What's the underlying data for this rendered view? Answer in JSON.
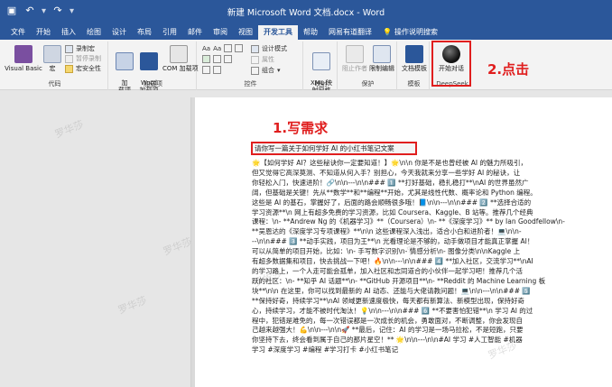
{
  "titlebar": {
    "title": "新建 Microsoft Word 文档.docx  -  Word",
    "qat": [
      "save-icon",
      "undo-icon",
      "redo-icon",
      "customize-icon"
    ]
  },
  "tabs": [
    {
      "label": "文件"
    },
    {
      "label": "开始"
    },
    {
      "label": "插入"
    },
    {
      "label": "绘图"
    },
    {
      "label": "设计"
    },
    {
      "label": "布局"
    },
    {
      "label": "引用"
    },
    {
      "label": "邮件"
    },
    {
      "label": "审阅"
    },
    {
      "label": "视图"
    },
    {
      "label": "开发工具"
    },
    {
      "label": "帮助"
    },
    {
      "label": "网易有道翻译"
    },
    {
      "label": "操作说明搜索"
    }
  ],
  "active_tab": "开发工具",
  "ribbon": {
    "code": {
      "label": "代码",
      "visual_basic": "Visual Basic",
      "macros": "宏",
      "record_macro": "录制宏",
      "pause_recording": "暂停录制",
      "macro_security": "宏安全性"
    },
    "addins": {
      "label": "加载项",
      "addins_btn": "加\n载项",
      "word_addins": "Word\n加载项",
      "com_addins": "COM 加载项"
    },
    "controls": {
      "label": "控件",
      "design_mode": "设计模式",
      "properties": "属性",
      "group": "组合"
    },
    "mapping": {
      "label": "映射",
      "xml_mapping": "XML 映\n射窗格"
    },
    "protect": {
      "label": "保护",
      "block_authors": "阻止作者",
      "restrict_editing": "限制编辑"
    },
    "templates": {
      "label": "模板",
      "document_template": "文档模板"
    },
    "deepseek": {
      "label": "DeepSeek",
      "start_chat": "开始对话"
    }
  },
  "annotations": {
    "step1": "1.写需求",
    "step2": "2.点击"
  },
  "document": {
    "prompt": "请你写一篇关于如何学好 AI 的小红书笔记文案",
    "lines": [
      "🌟【如何学好 AI？这些秘诀你一定要知道！】🌟\\n\\n 你是不是也曾经被 AI 的魅力所吸引，",
      "但又觉得它高深莫测、不知道从何入手？别担心，今天我就来分享一些学好 AI 的秘诀，让",
      "你轻松入门，快速进阶！🔗\\n\\n---\\n\\n### 1️⃣ **打好基础，稳扎稳打**\\nAI 的世界虽然广",
      "阔，但基础是关键！先从**数学**和**编程**开始，尤其是线性代数、概率论和 Python 编程。",
      "这些是 AI 的基石，掌握好了，后面的路会顺畅很多哦！📘\\n\\n---\\n\\n### 2️⃣ **选择合适的",
      "学习资源**\\n 网上有超多免费的学习资源，比如 Coursera、Kaggle、B 站等。推荐几个经典",
      "课程：\\n- **Andrew Ng 的《机器学习》**（Coursera）\\n- **《深度学习》** by Ian Goodfellow\\n-",
      "**吴恩达的《深度学习专项课程》**\\n\\n 这些课程深入浅出，适合小白和进阶者！💻\\n\\n-",
      "--\\n\\n### 3️⃣ **动手实践，项目为王**\\n 光看理论是不够的，动手做项目才能真正掌握 AI！",
      "可以从简单的项目开始，比如：\\n- 手写数字识别\\n- 情感分析\\n- 图像分类\\n\\nKaggle 上",
      "有超多数据集和项目，快去挑战一下吧！🔥\\n\\n---\\n\\n### 4️⃣ **加入社区，交流学习**\\nAI",
      "的学习路上，一个人走可能会孤单，加入社区和志同道合的小伙伴一起学习吧！推荐几个活",
      "跃的社区：\\n- **知乎 AI 话题**\\n- **GitHub 开源项目**\\n- **Reddit 的 Machine Learning 板",
      "块**\\n\\n 在这里，你可以找到最新的 AI 动态、还能与大佬请教问题！💻\\n\\n---\\n\\n### 5️⃣",
      "**保持好奇，持续学习**\\nAI 领域更新速度极快，每天都有新算法、新模型出现，保持好奇",
      "心，持续学习，才能不被时代淘汰！💡\\n\\n---\\n\\n### 6️⃣ **不要害怕犯错**\\n 学习 AI 的过",
      "程中，犯错是难免的，每一次错误都是一次成长的机会，勇敢面对，不断调整，你会发现自",
      "己越来越强大！💪\\n\\n---\\n\\n🚀 **最后，记住：AI 的学习是一场马拉松，不是短跑，只要",
      "你坚持下去，终会看到属于自己的那片星空！** 🌟\\n\\n---\\n\\n#AI 学习 #人工智能 #机器",
      "学习 #深度学习 #编程 #学习打卡 #小红书笔记"
    ]
  },
  "watermark": "罗华莎",
  "colors": {
    "word_blue": "#2b579a",
    "annotation_red": "#e01e1e"
  }
}
